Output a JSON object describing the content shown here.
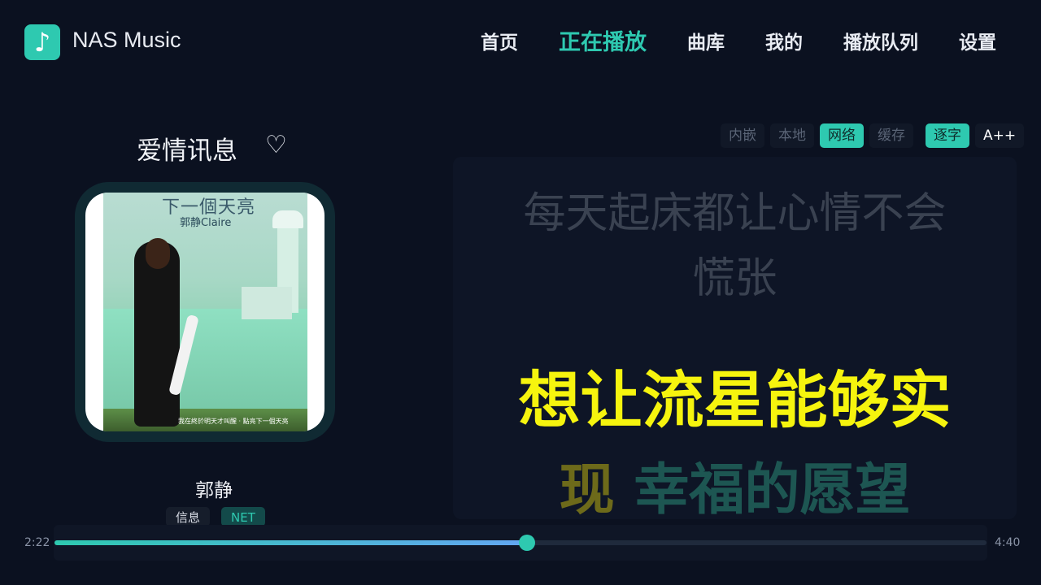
{
  "app": {
    "title": "NAS Music",
    "logo_icon": "music-note-icon"
  },
  "nav": {
    "items": [
      {
        "label": "首页"
      },
      {
        "label": "正在播放",
        "active": true
      },
      {
        "label": "曲库"
      },
      {
        "label": "我的"
      },
      {
        "label": "播放队列"
      },
      {
        "label": "设置"
      }
    ]
  },
  "song": {
    "title": "爱情讯息",
    "favorite_icon": "heart-outline-icon",
    "artist": "郭静",
    "tags": [
      "信息",
      "NET"
    ]
  },
  "album_art": {
    "title_text": "下一個天亮",
    "artist_text": "郭静Claire",
    "caption_text": "我在終於明天才叫醒 · 點亮下一個天亮"
  },
  "lyrics_sources": {
    "options": [
      "内嵌",
      "本地",
      "网络",
      "缓存"
    ],
    "selected": "网络",
    "mode_label": "逐字",
    "font_size_label": "A++"
  },
  "lyrics": {
    "previous_line_1": "每天起床都让心情不会",
    "previous_line_2": "慌张",
    "current_line": "想让流星能够实",
    "next_line_sung": "现",
    "next_line_rest": "幸福的愿望"
  },
  "playback": {
    "current_time": "2:22",
    "total_time": "4:40",
    "progress": 0.507
  },
  "colors": {
    "accent": "#2ec9b0",
    "background": "#0b1120",
    "lyric_highlight": "#f6f40e"
  }
}
